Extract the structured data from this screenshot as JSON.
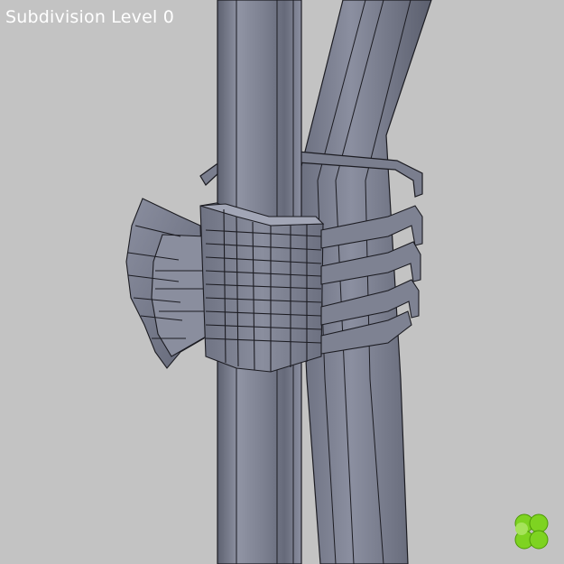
{
  "viewport": {
    "label": "Subdivision Level 0",
    "background_color": "#c3c3c3",
    "mesh_color": "#7f8393",
    "mesh_shadow_color": "#5b5f6e",
    "mesh_highlight_color": "#a4a8b8",
    "edge_color": "#1c1c22",
    "objects": [
      {
        "name": "vertical-tube"
      },
      {
        "name": "slanted-tube"
      },
      {
        "name": "clamp-bracket"
      },
      {
        "name": "clamp-wing"
      }
    ]
  },
  "logo": {
    "icon": "clover-logo-icon",
    "color": "#7ed321"
  }
}
